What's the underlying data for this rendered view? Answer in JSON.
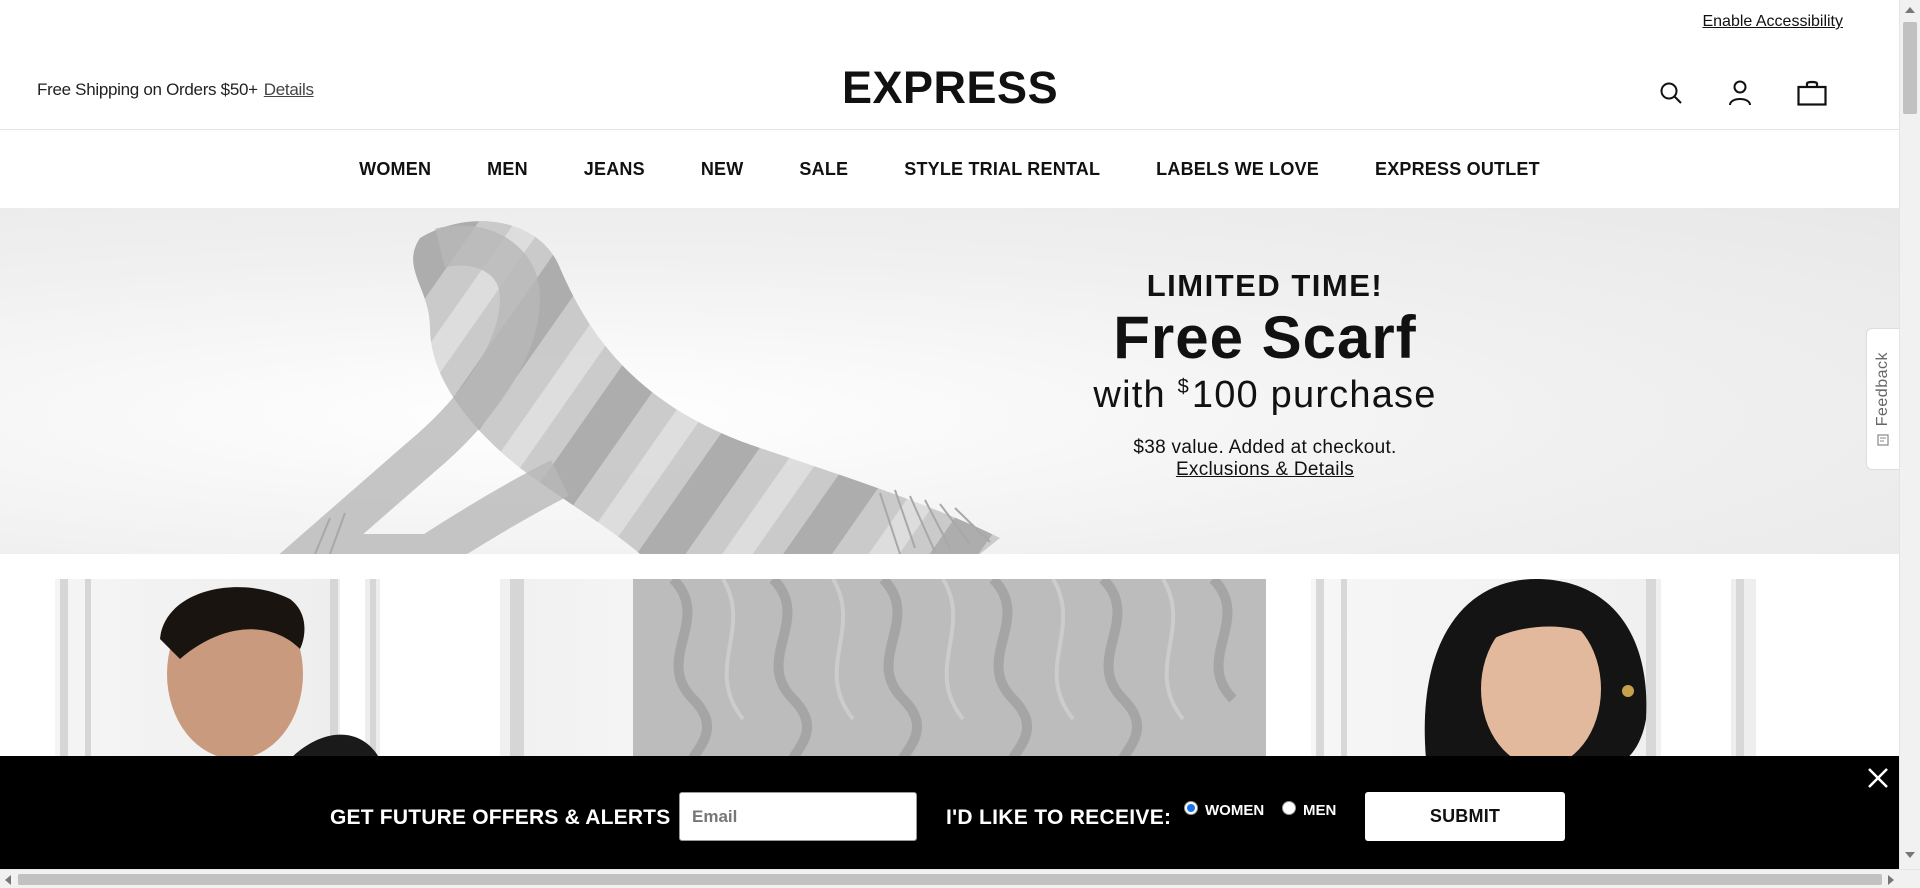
{
  "topbar": {
    "accessibility_label": "Enable Accessibility"
  },
  "header": {
    "shipping_text": "Free Shipping on Orders $50+",
    "shipping_link": "Details",
    "logo": "EXPRESS",
    "icons": [
      "search-icon",
      "account-icon",
      "bag-icon"
    ]
  },
  "nav": {
    "items": [
      {
        "label": "WOMEN"
      },
      {
        "label": "MEN"
      },
      {
        "label": "JEANS"
      },
      {
        "label": "NEW"
      },
      {
        "label": "SALE"
      },
      {
        "label": "STYLE TRIAL RENTAL"
      },
      {
        "label": "LABELS WE LOVE"
      },
      {
        "label": "EXPRESS OUTLET"
      }
    ]
  },
  "hero": {
    "kicker": "LIMITED TIME!",
    "headline": "Free Scarf",
    "sub_prefix": "with ",
    "sub_currency": "$",
    "sub_amount": "100 purchase",
    "note": "$38 value. Added at checkout.",
    "details_link": "Exclusions & Details"
  },
  "feedback": {
    "label": "Feedback"
  },
  "signup": {
    "title": "GET FUTURE OFFERS & ALERTS",
    "email_placeholder": "Email",
    "receive_label": "I'D LIKE TO RECEIVE:",
    "options": [
      {
        "label": "WOMEN",
        "selected": true
      },
      {
        "label": "MEN",
        "selected": false
      }
    ],
    "submit_label": "SUBMIT"
  },
  "colors": {
    "signup_bg": "#000000",
    "radio_selected": "#1a73e8",
    "text": "#111111"
  }
}
